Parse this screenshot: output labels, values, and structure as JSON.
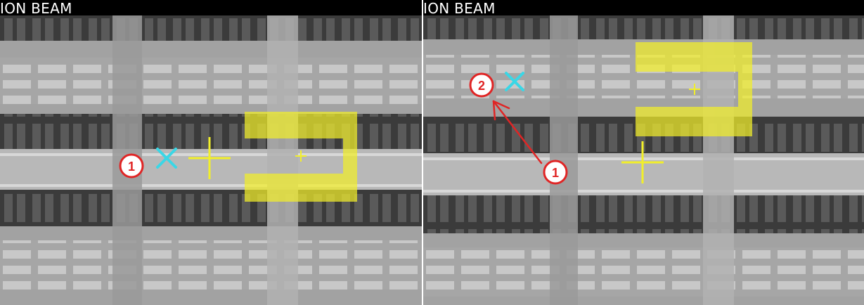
{
  "panels": [
    {
      "id": "left",
      "title": "ION BEAM",
      "markers": [
        {
          "label": "1"
        }
      ]
    },
    {
      "id": "right",
      "title": "ION BEAM",
      "markers": [
        {
          "label": "1"
        },
        {
          "label": "2"
        }
      ]
    }
  ],
  "colors": {
    "highlight": "#f2ef2a",
    "cyan_mark": "#3ad7e6",
    "marker_red": "#e02525",
    "background_gray": "#a2a2a2"
  }
}
